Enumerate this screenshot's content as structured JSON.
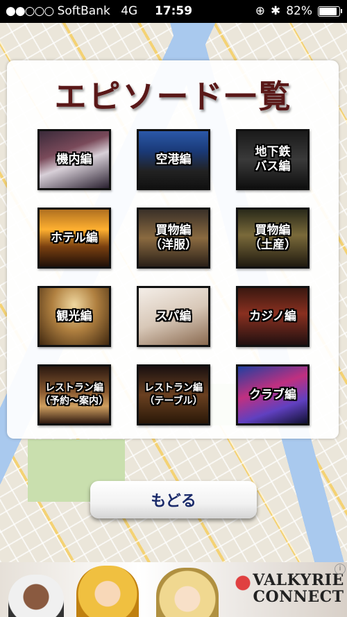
{
  "status_bar": {
    "signal": "●●○○○",
    "carrier": "SoftBank",
    "network": "4G",
    "time": "17:59",
    "battery": "82%",
    "battery_level": 0.82
  },
  "panel": {
    "title": "エピソード一覧"
  },
  "episodes": [
    {
      "label": "機内編"
    },
    {
      "label": "空港編"
    },
    {
      "label": "地下鉄\nバス編"
    },
    {
      "label": "ホテル編"
    },
    {
      "label": "買物編\n（洋服）"
    },
    {
      "label": "買物編\n（土産）"
    },
    {
      "label": "観光編"
    },
    {
      "label": "スパ編"
    },
    {
      "label": "カジノ編"
    },
    {
      "label": "レストラン編\n（予約〜案内）"
    },
    {
      "label": "レストラン編\n（テーブル）"
    },
    {
      "label": "クラブ編"
    }
  ],
  "back_button": {
    "label": "もどる"
  },
  "ad_banner": {
    "title_line1": "VALKYRIE",
    "title_line2": "CONNECT"
  }
}
